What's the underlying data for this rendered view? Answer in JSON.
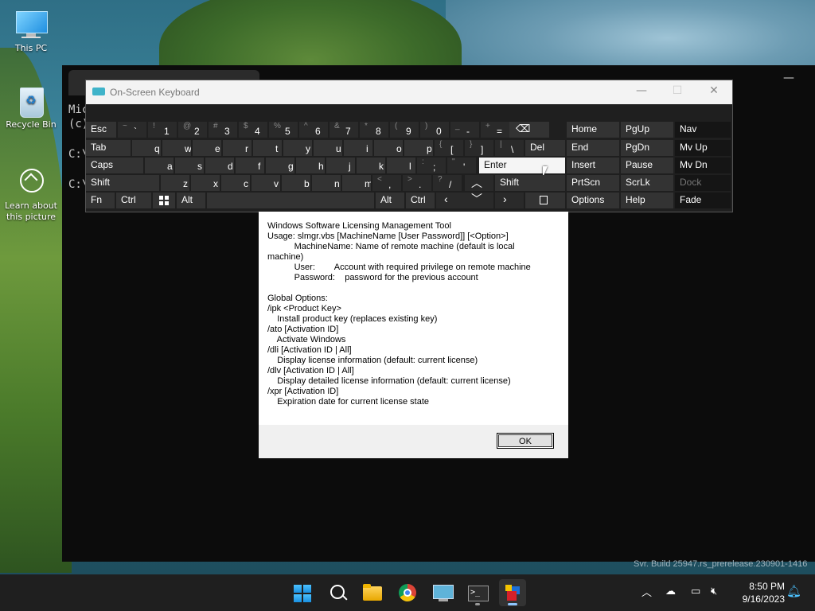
{
  "desktop": {
    "icons": [
      {
        "label": "This PC"
      },
      {
        "label": "Recycle Bin"
      },
      {
        "label": "Learn about this picture"
      }
    ]
  },
  "console": {
    "lines": [
      "Mic",
      "(c)",
      "C:\\",
      "C:\\"
    ]
  },
  "osk": {
    "title": "On-Screen Keyboard",
    "controls": {
      "minimize": "—",
      "maximize": "☐",
      "close": "✕"
    },
    "keys": {
      "esc": "Esc",
      "tab": "Tab",
      "caps": "Caps",
      "shift_l": "Shift",
      "fn": "Fn",
      "ctrl_l": "Ctrl",
      "alt_l": "Alt",
      "del": "Del",
      "enter": "Enter",
      "shift_r": "Shift",
      "alt_r": "Alt",
      "ctrl_r": "Ctrl",
      "row1": [
        {
          "s": "~",
          "m": "`"
        },
        {
          "s": "!",
          "m": "1"
        },
        {
          "s": "@",
          "m": "2"
        },
        {
          "s": "#",
          "m": "3"
        },
        {
          "s": "$",
          "m": "4"
        },
        {
          "s": "%",
          "m": "5"
        },
        {
          "s": "^",
          "m": "6"
        },
        {
          "s": "&",
          "m": "7"
        },
        {
          "s": "*",
          "m": "8"
        },
        {
          "s": "(",
          "m": "9"
        },
        {
          "s": ")",
          "m": "0"
        },
        {
          "s": "_",
          "m": "-"
        },
        {
          "s": "+",
          "m": "="
        }
      ],
      "row2": [
        "q",
        "w",
        "e",
        "r",
        "t",
        "y",
        "u",
        "i",
        "o",
        "p"
      ],
      "row2_sym": [
        {
          "s": "{",
          "m": "["
        },
        {
          "s": "}",
          "m": "]"
        },
        {
          "s": "|",
          "m": "\\"
        }
      ],
      "row3": [
        "a",
        "s",
        "d",
        "f",
        "g",
        "h",
        "j",
        "k",
        "l"
      ],
      "row3_sym": [
        {
          "s": ":",
          "m": ";"
        },
        {
          "s": "\"",
          "m": "'"
        }
      ],
      "row4": [
        "z",
        "x",
        "c",
        "v",
        "b",
        "n",
        "m"
      ],
      "row4_sym": [
        {
          "s": "<",
          "m": ","
        },
        {
          "s": ">",
          "m": "."
        },
        {
          "s": "?",
          "m": "/"
        }
      ],
      "nav": [
        [
          "Home",
          "PgUp",
          "Nav"
        ],
        [
          "End",
          "PgDn",
          "Mv Up"
        ],
        [
          "Insert",
          "Pause",
          "Mv Dn"
        ],
        [
          "PrtScn",
          "ScrLk",
          "Dock"
        ],
        [
          "Options",
          "Help",
          "Fade"
        ]
      ]
    }
  },
  "dialog": {
    "body": "Windows Software Licensing Management Tool\nUsage: slmgr.vbs [MachineName [User Password]] [<Option>]\n           MachineName: Name of remote machine (default is local\nmachine)\n           User:        Account with required privilege on remote machine\n           Password:    password for the previous account\n\nGlobal Options:\n/ipk <Product Key>\n    Install product key (replaces existing key)\n/ato [Activation ID]\n    Activate Windows\n/dli [Activation ID | All]\n    Display license information (default: current license)\n/dlv [Activation ID | All]\n    Display detailed license information (default: current license)\n/xpr [Activation ID]\n    Expiration date for current license state",
    "ok_label": "OK"
  },
  "watermark": "Svr. Build 25947.rs_prerelease.230901-1416",
  "taskbar": {
    "apps": [
      "start-icon",
      "search-icon",
      "file-explorer-icon",
      "chrome-icon",
      "remote-desktop-icon",
      "terminal-icon",
      "osk-app-icon"
    ],
    "time": "8:50 PM",
    "date": "9/16/2023"
  },
  "colors": {
    "accent": "#8fc5ff",
    "osk_bg": "#1f1f1f",
    "key": "#333333"
  }
}
